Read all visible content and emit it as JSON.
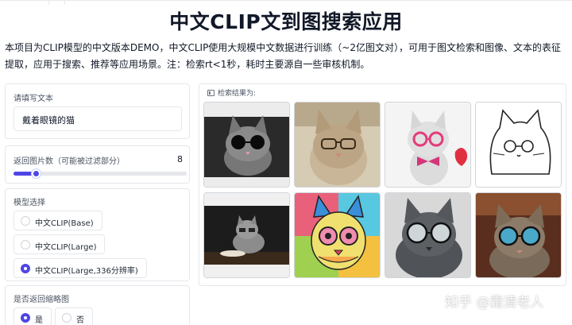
{
  "app": {
    "title": "中文CLIP文到图搜索应用",
    "description": "本项目为CLIP模型的中文版本DEMO，中文CLIP使用大规模中文数据进行训练（~2亿图文对），可用于图文检索和图像、文本的表征提取，应用于搜索、推荐等应用场景。注：检索rt<1秒，耗时主要源自一些审核机制。"
  },
  "query": {
    "label": "请填写文本",
    "value": "戴着眼镜的猫"
  },
  "num_images": {
    "label": "返回图片数（可能被过滤部分）",
    "value": "8",
    "fraction": 0.13
  },
  "model": {
    "label": "模型选择",
    "options": [
      "中文CLIP(Base)",
      "中文CLIP(Large)",
      "中文CLIP(Large,336分辨率)"
    ],
    "selected_index": 2
  },
  "thumbnail": {
    "label": "是否返回缩略图",
    "options": [
      "是",
      "否"
    ],
    "selected_index": 0
  },
  "results": {
    "label": "检索结果为:",
    "icon": "image-icon",
    "items": [
      {
        "name": "result-cat-1"
      },
      {
        "name": "result-cat-2"
      },
      {
        "name": "result-cat-3"
      },
      {
        "name": "result-cat-4"
      },
      {
        "name": "result-cat-5"
      },
      {
        "name": "result-cat-6"
      },
      {
        "name": "result-cat-7"
      },
      {
        "name": "result-cat-8"
      }
    ]
  },
  "watermark": "知乎 @霜清老人",
  "colors": {
    "accent": "#4f46e5",
    "border": "#e5e7eb"
  }
}
